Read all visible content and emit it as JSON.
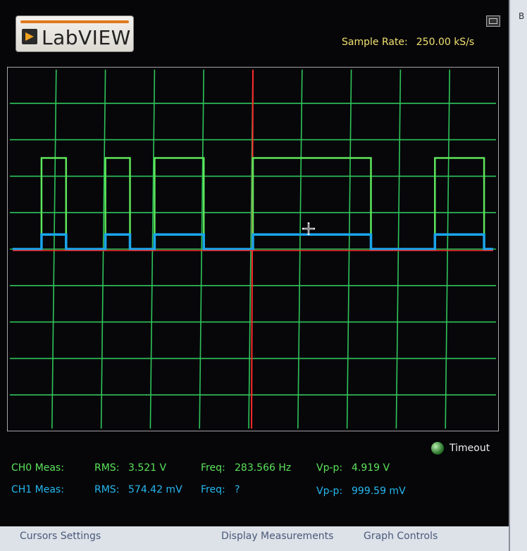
{
  "app": {
    "logo_text": "LabVIEW"
  },
  "header": {
    "sample_rate_label": "Sample Rate:",
    "sample_rate_value": "250.00 kS/s"
  },
  "status": {
    "timeout_label": "Timeout"
  },
  "measurements": {
    "ch0": {
      "label": "CH0 Meas:",
      "rms_label": "RMS:",
      "rms_value": "3.521 V",
      "freq_label": "Freq:",
      "freq_value": "283.566 Hz",
      "vpp_label": "Vp-p:",
      "vpp_value": "4.919 V"
    },
    "ch1": {
      "label": "CH1 Meas:",
      "rms_label": "RMS:",
      "rms_value": "574.42 mV",
      "freq_label": "Freq:",
      "freq_value": "?",
      "vpp_label": "Vp-p:",
      "vpp_value": "999.59 mV"
    }
  },
  "tabs": {
    "cursors": "Cursors Settings",
    "display": "Display Measurements",
    "graph": "Graph Controls"
  },
  "right_strip_text": "B",
  "colors": {
    "grid": "#2fc45a",
    "ch0": "#5ee65a",
    "ch1": "#1aa6ec",
    "trigger": "#ff2a2a",
    "background": "#060608"
  },
  "chart_data": {
    "type": "line",
    "grid": {
      "x_divisions": 10,
      "y_divisions": 10
    },
    "series": [
      {
        "level_high": 0.75,
        "level_low": 0.5,
        "pulses": [
          [
            0.07,
            0.12
          ],
          [
            0.2,
            0.25
          ],
          [
            0.3,
            0.4
          ],
          [
            0.5,
            0.74
          ],
          [
            0.87,
            0.97
          ]
        ]
      },
      {
        "level_high": 0.54,
        "level_low": 0.5,
        "pulses": [
          [
            0.07,
            0.12
          ],
          [
            0.2,
            0.25
          ],
          [
            0.3,
            0.4
          ],
          [
            0.5,
            0.74
          ],
          [
            0.87,
            0.97
          ]
        ]
      }
    ]
  }
}
